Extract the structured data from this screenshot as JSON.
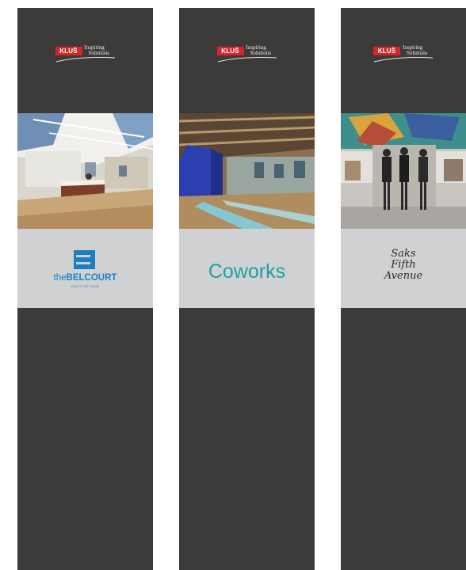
{
  "logo": {
    "badge": "KLUŠ",
    "tagline_line1": "Inspiring",
    "tagline_line2": "Solutions"
  },
  "banners": [
    {
      "brand_name": "theBELCOURT",
      "brand_prefix": "the",
      "brand_main": "BELCOURT",
      "brand_tagline": "ENJOY THE SHOW",
      "photo": "office-reception-photo"
    },
    {
      "brand_name": "Coworks",
      "photo": "coworking-space-photo"
    },
    {
      "brand_name": "Saks Fifth Avenue",
      "brand_line1": "Saks",
      "brand_line2": "Fifth",
      "brand_line3": "Avenue",
      "photo": "store-mannequins-photo"
    }
  ],
  "colors": {
    "banner_bg": "#3c3b39",
    "brand_panel_bg": "#d0d1d3",
    "logo_red": "#d7252b",
    "belcourt_blue": "#1d7fc1",
    "coworks_teal": "#1f9fa2"
  }
}
